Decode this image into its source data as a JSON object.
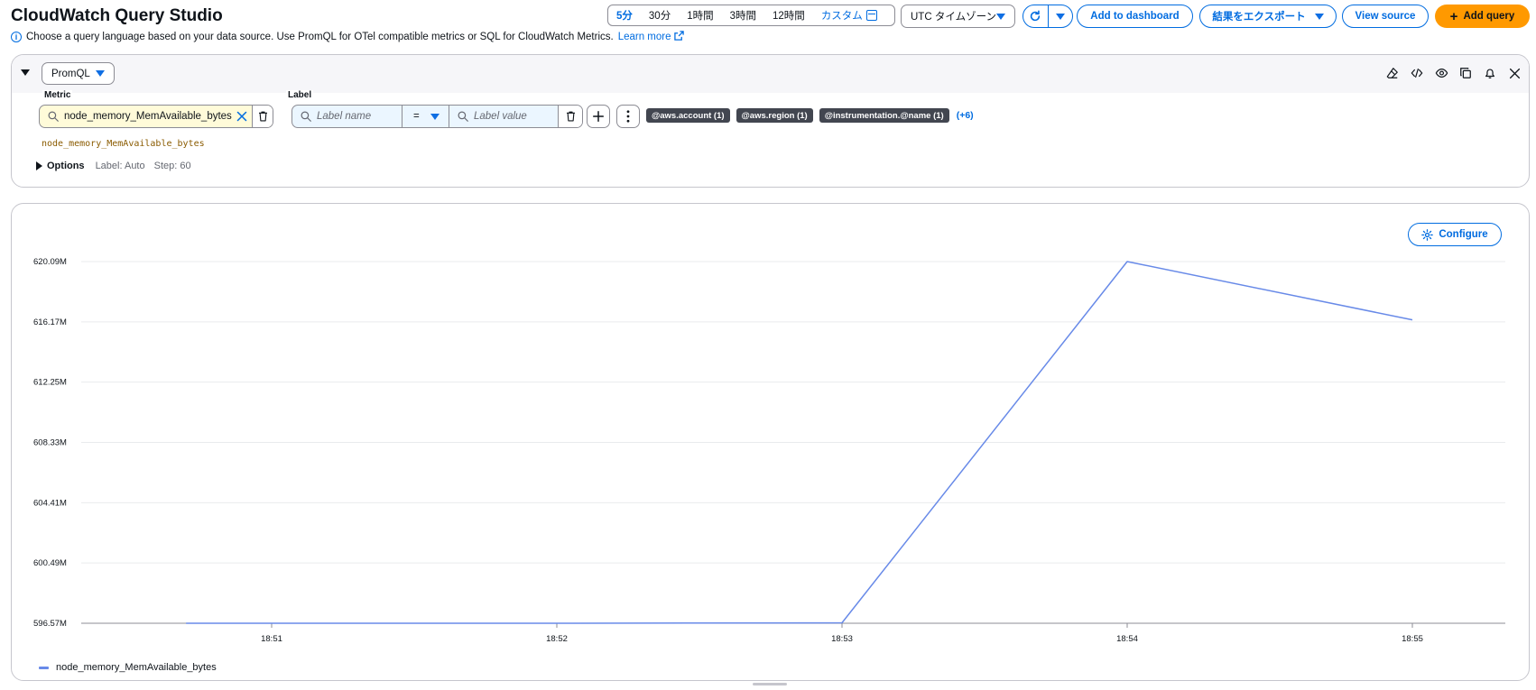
{
  "app": {
    "title": "CloudWatch Query Studio"
  },
  "toolbar": {
    "time_ranges": [
      "5分",
      "30分",
      "1時間",
      "3時間",
      "12時間"
    ],
    "custom_label": "カスタム",
    "timezone": "UTC タイムゾーン",
    "add_to_dashboard": "Add to dashboard",
    "export_results": "結果をエクスポート",
    "view_source": "View source",
    "add_query": "Add query"
  },
  "info": {
    "text": "Choose a query language based on your data source. Use PromQL for OTel compatible metrics or SQL for CloudWatch Metrics.",
    "link": "Learn more"
  },
  "query": {
    "language": "PromQL",
    "metric_label": "Metric",
    "metric_value": "node_memory_MemAvailable_bytes",
    "label_label": "Label",
    "label_name_placeholder": "Label name",
    "operator": "=",
    "label_value_placeholder": "Label value",
    "chips": [
      "@aws.account (1)",
      "@aws.region (1)",
      "@instrumentation.@name (1)"
    ],
    "more_chips": "(+6)",
    "query_text": "node_memory_MemAvailable_bytes",
    "options": {
      "title": "Options",
      "label": "Label: Auto",
      "step": "Step: 60"
    }
  },
  "chart": {
    "configure_label": "Configure",
    "legend": "node_memory_MemAvailable_bytes"
  },
  "chart_data": {
    "type": "line",
    "title": "",
    "xlabel": "",
    "ylabel": "",
    "x_ticks": [
      "18:51",
      "18:52",
      "18:53",
      "18:54",
      "18:55"
    ],
    "y_ticks": [
      "596.57M",
      "600.49M",
      "604.41M",
      "608.33M",
      "612.25M",
      "616.17M",
      "620.09M"
    ],
    "ylim": [
      596.57,
      620.09
    ],
    "grid": true,
    "legend_position": "bottom-left",
    "series": [
      {
        "name": "node_memory_MemAvailable_bytes",
        "color": "#688ae8",
        "points": [
          {
            "x": "18:50:42",
            "y": 596.57
          },
          {
            "x": "18:52",
            "y": 596.57
          },
          {
            "x": "18:53",
            "y": 596.6
          },
          {
            "x": "18:54",
            "y": 620.09
          },
          {
            "x": "18:55",
            "y": 616.3
          }
        ]
      }
    ]
  }
}
